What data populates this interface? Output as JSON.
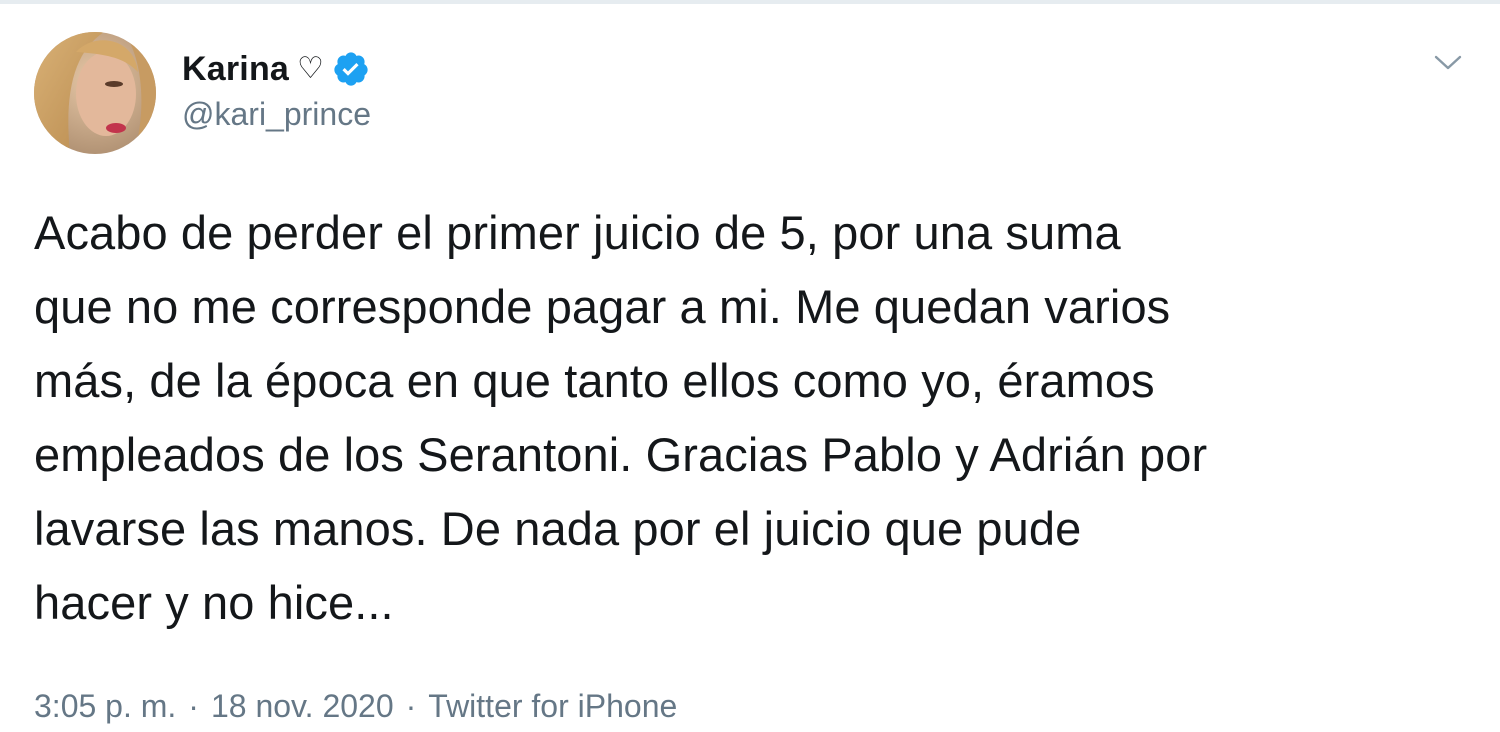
{
  "author": {
    "display_name": "Karina",
    "name_emoji": "♡",
    "verified": true,
    "handle": "@kari_prince"
  },
  "tweet": {
    "text": "Acabo de perder el primer juicio de 5, por una suma\nque no me corresponde pagar a mi. Me quedan varios\nmás, de la época en que tanto ellos como yo, éramos\nempleados de los Serantoni. Gracias Pablo y Adrián por\nlavarse las manos. De nada por el juicio que pude\nhacer y no hice...",
    "time": "3:05 p. m.",
    "date": "18 nov. 2020",
    "separator": "·",
    "source": "Twitter for iPhone"
  },
  "icons": {
    "verified": "verified-badge-icon",
    "more": "chevron-down-icon",
    "avatar": "profile-photo"
  },
  "colors": {
    "verified_blue": "#1da1f2",
    "secondary_text": "#657786",
    "primary_text": "#14171a"
  }
}
